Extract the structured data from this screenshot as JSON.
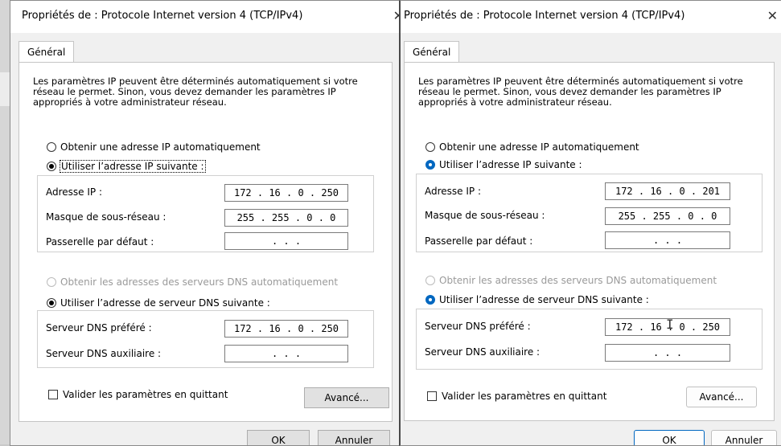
{
  "left_dialog": {
    "title": "Propriétés de : Protocole Internet version 4 (TCP/IPv4)",
    "close_glyph": "✕",
    "tab_general": "Général",
    "intro": "Les paramètres IP peuvent être déterminés automatiquement si votre réseau le permet. Sinon, vous devez demander les paramètres IP appropriés à votre administrateur réseau.",
    "radio_ip_auto": "Obtenir une adresse IP automatiquement",
    "radio_ip_manual": "Utiliser l’adresse IP suivante :",
    "ip_label": "Adresse IP :",
    "ip_value": "172 . 16 . 0 . 250",
    "mask_label": "Masque de sous-réseau :",
    "mask_value": "255 . 255 . 0 . 0",
    "gateway_label": "Passerelle par défaut :",
    "gateway_value": ". . .",
    "radio_dns_auto": "Obtenir les adresses des serveurs DNS automatiquement",
    "radio_dns_manual": "Utiliser l’adresse de serveur DNS suivante :",
    "dns_pref_label": "Serveur DNS préféré :",
    "dns_pref_value": "172 . 16 . 0 . 250",
    "dns_aux_label": "Serveur DNS auxiliaire :",
    "dns_aux_value": ". . .",
    "validate_label": "Valider les paramètres en quittant",
    "advanced_button": "Avancé...",
    "ok_button": "OK",
    "cancel_button": "Annuler"
  },
  "right_dialog": {
    "title": "Propriétés de : Protocole Internet version 4 (TCP/IPv4)",
    "close_glyph": "✕",
    "tab_general": "Général",
    "intro": "Les paramètres IP peuvent être déterminés automatiquement si votre réseau le permet. Sinon, vous devez demander les paramètres IP appropriés à votre administrateur réseau.",
    "radio_ip_auto": "Obtenir une adresse IP automatiquement",
    "radio_ip_manual": "Utiliser l’adresse IP suivante :",
    "ip_label": "Adresse IP :",
    "ip_value": "172 . 16 . 0 . 201",
    "mask_label": "Masque de sous-réseau :",
    "mask_value": "255 . 255 . 0 . 0",
    "gateway_label": "Passerelle par défaut :",
    "gateway_value": ". . .",
    "radio_dns_auto": "Obtenir les adresses des serveurs DNS automatiquement",
    "radio_dns_manual": "Utiliser l’adresse de serveur DNS suivante :",
    "dns_pref_label": "Serveur DNS préféré :",
    "dns_pref_value": "172 . 16 . 0 . 250",
    "dns_aux_label": "Serveur DNS auxiliaire :",
    "dns_aux_value": ". . .",
    "validate_label": "Valider les paramètres en quittant",
    "advanced_button": "Avancé...",
    "ok_button": "OK",
    "cancel_button": "Annuler",
    "accent_color": "#0067c0"
  }
}
